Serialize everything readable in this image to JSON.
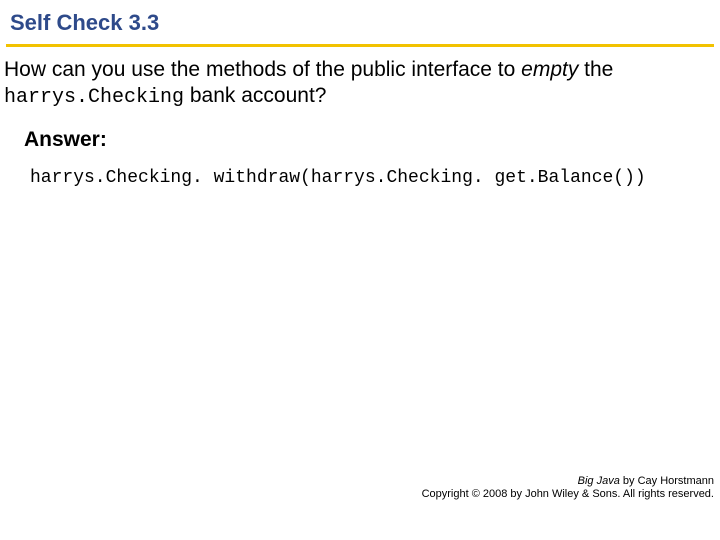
{
  "title": "Self Check 3.3",
  "question": {
    "part1": "How can you use the methods of the public interface to ",
    "emphasis": "empty",
    "part2": " the ",
    "code": "harrys.Checking",
    "part3": " bank account?"
  },
  "answer": {
    "label": "Answer:",
    "code": "harrys.Checking. withdraw(harrys.Checking. get.Balance())"
  },
  "footer": {
    "book": "Big Java",
    "byline": " by Cay Horstmann",
    "copyright": "Copyright © 2008 by John Wiley & Sons. All rights reserved."
  }
}
